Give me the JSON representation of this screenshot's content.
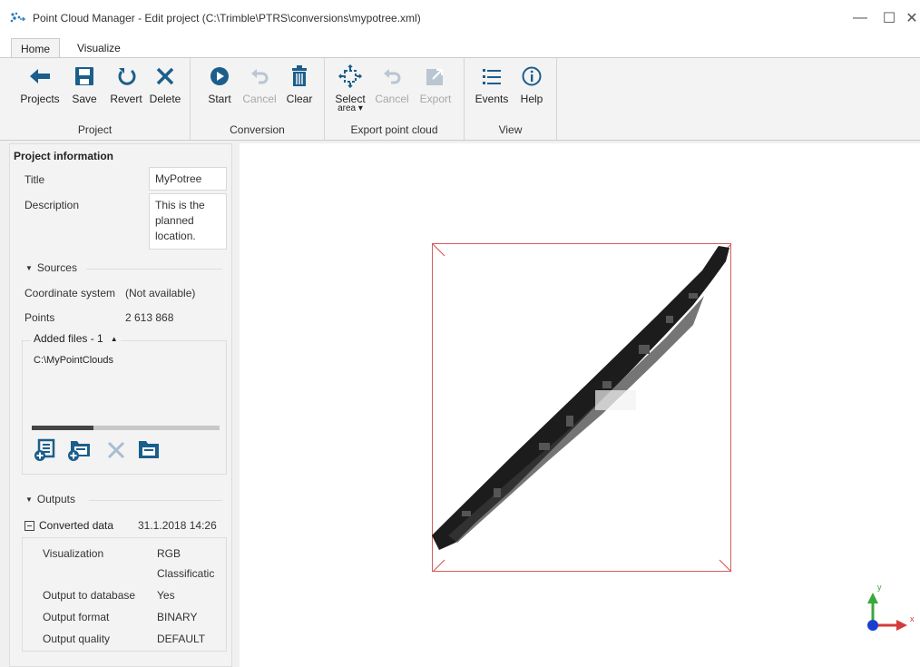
{
  "window": {
    "title": "Point Cloud Manager  -  Edit project (C:\\Trimble\\PTRS\\conversions\\mypotree.xml)",
    "controls": {
      "minimize": "—",
      "maximize": "☐",
      "close": "✕"
    }
  },
  "tabs": [
    {
      "label": "Home",
      "active": true
    },
    {
      "label": "Visualize",
      "active": false
    }
  ],
  "ribbon": {
    "groups": [
      {
        "label": "Project",
        "buttons": [
          {
            "label": "Projects",
            "icon": "arrow-left-icon",
            "enabled": true
          },
          {
            "label": "Save",
            "icon": "save-icon",
            "enabled": true
          },
          {
            "label": "Revert",
            "icon": "revert-icon",
            "enabled": true
          },
          {
            "label": "Delete",
            "icon": "delete-icon",
            "enabled": true
          }
        ]
      },
      {
        "label": "Conversion",
        "buttons": [
          {
            "label": "Start",
            "icon": "play-icon",
            "enabled": true
          },
          {
            "label": "Cancel",
            "icon": "undo-icon",
            "enabled": false
          },
          {
            "label": "Clear",
            "icon": "trash-icon",
            "enabled": true
          }
        ]
      },
      {
        "label": "Export point cloud",
        "buttons": [
          {
            "label": "Select",
            "sublabel": "area ▾",
            "icon": "select-area-icon",
            "enabled": true
          },
          {
            "label": "Cancel",
            "icon": "undo-icon",
            "enabled": false
          },
          {
            "label": "Export",
            "icon": "export-icon",
            "enabled": false
          }
        ]
      },
      {
        "label": "View",
        "buttons": [
          {
            "label": "Events",
            "icon": "list-icon",
            "enabled": true
          },
          {
            "label": "Help",
            "icon": "info-icon",
            "enabled": true
          }
        ]
      }
    ]
  },
  "project_info": {
    "heading": "Project information",
    "title_label": "Title",
    "title_value": "MyPotree",
    "description_label": "Description",
    "description_value": "This is the planned location."
  },
  "sources": {
    "heading": "Sources",
    "coord_label": "Coordinate system",
    "coord_value": "(Not available)",
    "points_label": "Points",
    "points_value": "2 613 868",
    "added_files_label": "Added files - 1",
    "files": [
      "C:\\MyPointClouds"
    ],
    "progress": 0.33
  },
  "outputs": {
    "heading": "Outputs",
    "converted_label": "Converted data",
    "converted_date": "31.1.2018 14:26",
    "rows": [
      {
        "label": "Visualization",
        "value": "RGB"
      },
      {
        "label": "",
        "value": "Classificatic"
      },
      {
        "label": "Output to database",
        "value": "Yes"
      },
      {
        "label": "Output format",
        "value": "BINARY"
      },
      {
        "label": "Output quality",
        "value": "DEFAULT"
      }
    ]
  },
  "axes": {
    "y": "y",
    "x": "x"
  },
  "colors": {
    "accent": "#1b5e8c",
    "bbox": "#d45d5d",
    "axis_y": "#3aa83a",
    "axis_x": "#d63a3a",
    "axis_z": "#1a3fcf"
  }
}
